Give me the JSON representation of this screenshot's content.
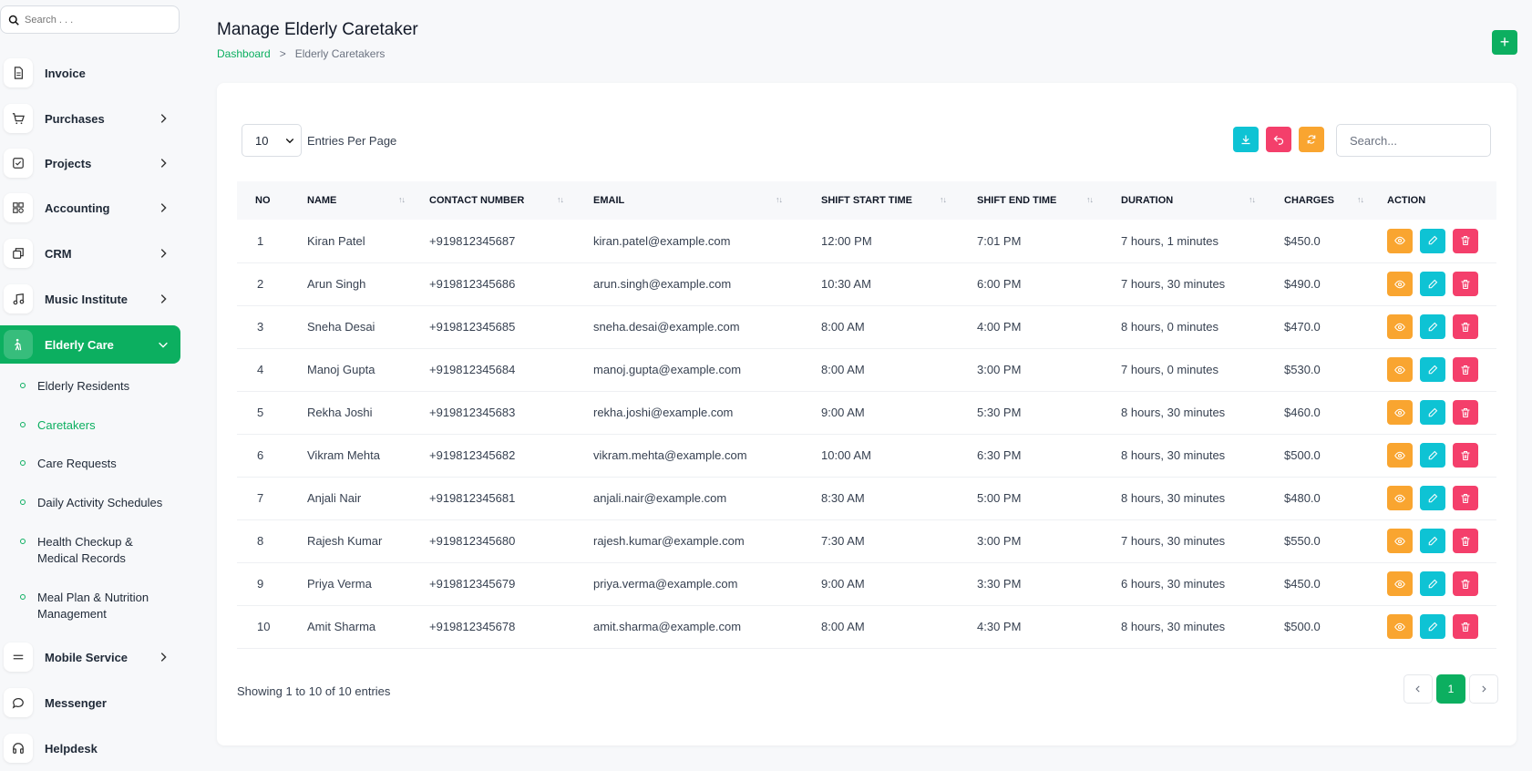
{
  "sidebar": {
    "search_placeholder": "Search . . .",
    "items": [
      {
        "label": "Invoice",
        "icon": "file-icon",
        "chevron": false
      },
      {
        "label": "Purchases",
        "icon": "cart-icon",
        "chevron": true
      },
      {
        "label": "Projects",
        "icon": "checkbox-icon",
        "chevron": true
      },
      {
        "label": "Accounting",
        "icon": "grid-icon",
        "chevron": true
      },
      {
        "label": "CRM",
        "icon": "copy-icon",
        "chevron": true
      },
      {
        "label": "Music Institute",
        "icon": "music-icon",
        "chevron": true
      },
      {
        "label": "Elderly Care",
        "icon": "elderly-icon",
        "chevron": true,
        "active": true
      },
      {
        "label": "Mobile Service",
        "icon": "menu-icon",
        "chevron": true
      },
      {
        "label": "Messenger",
        "icon": "chat-icon",
        "chevron": false
      },
      {
        "label": "Helpdesk",
        "icon": "headset-icon",
        "chevron": false
      }
    ],
    "sub_items": [
      {
        "label": "Elderly Residents"
      },
      {
        "label": "Caretakers",
        "active": true
      },
      {
        "label": "Care Requests"
      },
      {
        "label": "Daily Activity Schedules"
      },
      {
        "label": "Health Checkup & Medical Records"
      },
      {
        "label": "Meal Plan & Nutrition Management"
      }
    ]
  },
  "header": {
    "title": "Manage Elderly Caretaker",
    "breadcrumb_home": "Dashboard",
    "breadcrumb_sep": ">",
    "breadcrumb_current": "Elderly Caretakers",
    "add_label": "+"
  },
  "toolbar": {
    "entries_value": "10",
    "entries_label": "Entries Per Page",
    "search_placeholder": "Search...",
    "colors": {
      "download": "#0ec3d4",
      "reset": "#f43f6b",
      "refresh": "#f9a530"
    }
  },
  "table": {
    "columns": [
      "NO",
      "NAME",
      "CONTACT NUMBER",
      "EMAIL",
      "SHIFT START TIME",
      "SHIFT END TIME",
      "DURATION",
      "CHARGES",
      "ACTION"
    ],
    "rows": [
      [
        "1",
        "Kiran Patel",
        "+919812345687",
        "kiran.patel@example.com",
        "12:00 PM",
        "7:01 PM",
        "7 hours, 1 minutes",
        "$450.0"
      ],
      [
        "2",
        "Arun Singh",
        "+919812345686",
        "arun.singh@example.com",
        "10:30 AM",
        "6:00 PM",
        "7 hours, 30 minutes",
        "$490.0"
      ],
      [
        "3",
        "Sneha Desai",
        "+919812345685",
        "sneha.desai@example.com",
        "8:00 AM",
        "4:00 PM",
        "8 hours, 0 minutes",
        "$470.0"
      ],
      [
        "4",
        "Manoj Gupta",
        "+919812345684",
        "manoj.gupta@example.com",
        "8:00 AM",
        "3:00 PM",
        "7 hours, 0 minutes",
        "$530.0"
      ],
      [
        "5",
        "Rekha Joshi",
        "+919812345683",
        "rekha.joshi@example.com",
        "9:00 AM",
        "5:30 PM",
        "8 hours, 30 minutes",
        "$460.0"
      ],
      [
        "6",
        "Vikram Mehta",
        "+919812345682",
        "vikram.mehta@example.com",
        "10:00 AM",
        "6:30 PM",
        "8 hours, 30 minutes",
        "$500.0"
      ],
      [
        "7",
        "Anjali Nair",
        "+919812345681",
        "anjali.nair@example.com",
        "8:30 AM",
        "5:00 PM",
        "8 hours, 30 minutes",
        "$480.0"
      ],
      [
        "8",
        "Rajesh Kumar",
        "+919812345680",
        "rajesh.kumar@example.com",
        "7:30 AM",
        "3:00 PM",
        "7 hours, 30 minutes",
        "$550.0"
      ],
      [
        "9",
        "Priya Verma",
        "+919812345679",
        "priya.verma@example.com",
        "9:00 AM",
        "3:30 PM",
        "6 hours, 30 minutes",
        "$450.0"
      ],
      [
        "10",
        "Amit Sharma",
        "+919812345678",
        "amit.sharma@example.com",
        "8:00 AM",
        "4:30 PM",
        "8 hours, 30 minutes",
        "$500.0"
      ]
    ],
    "action_colors": {
      "view": "#f9a530",
      "edit": "#0ec3d4",
      "delete": "#f43f6b"
    }
  },
  "footer": {
    "showing": "Showing 1 to 10 of 10 entries",
    "current_page": "1"
  },
  "colors": {
    "accent": "#0caf60"
  }
}
